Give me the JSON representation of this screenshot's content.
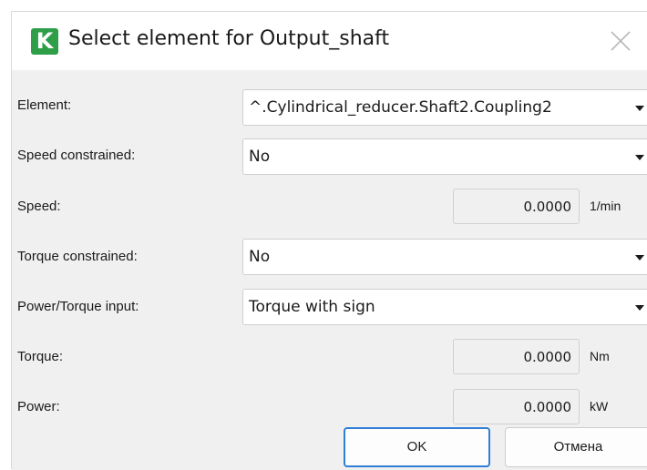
{
  "window": {
    "app_icon_letter": "K",
    "title": "Select element for Output_shaft"
  },
  "form": {
    "element": {
      "label": "Element:",
      "value": "^.Cylindrical_reducer.Shaft2.Coupling2"
    },
    "speed_constrained": {
      "label": "Speed constrained:",
      "value": "No"
    },
    "speed": {
      "label": "Speed:",
      "value": "0.0000",
      "unit": "1/min"
    },
    "torque_constrained": {
      "label": "Torque constrained:",
      "value": "No"
    },
    "power_torque_input": {
      "label": "Power/Torque input:",
      "value": "Torque with sign"
    },
    "torque": {
      "label": "Torque:",
      "value": "0.0000",
      "unit": "Nm"
    },
    "power": {
      "label": "Power:",
      "value": "0.0000",
      "unit": "kW"
    }
  },
  "buttons": {
    "ok": "OK",
    "cancel": "Отмена"
  },
  "colors": {
    "app_icon": "#2e9e48",
    "default_button_border": "#2f7fd6",
    "content_background": "#f0f0f0"
  }
}
